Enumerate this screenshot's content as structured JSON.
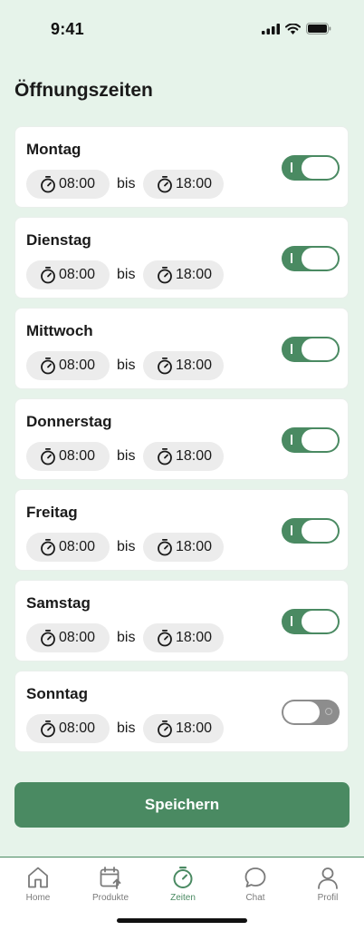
{
  "status_bar": {
    "time": "9:41"
  },
  "page": {
    "title": "Öffnungszeiten"
  },
  "days": [
    {
      "name": "Montag",
      "from": "08:00",
      "to": "18:00",
      "separator": "bis",
      "enabled": true
    },
    {
      "name": "Dienstag",
      "from": "08:00",
      "to": "18:00",
      "separator": "bis",
      "enabled": true
    },
    {
      "name": "Mittwoch",
      "from": "08:00",
      "to": "18:00",
      "separator": "bis",
      "enabled": true
    },
    {
      "name": "Donnerstag",
      "from": "08:00",
      "to": "18:00",
      "separator": "bis",
      "enabled": true
    },
    {
      "name": "Freitag",
      "from": "08:00",
      "to": "18:00",
      "separator": "bis",
      "enabled": true
    },
    {
      "name": "Samstag",
      "from": "08:00",
      "to": "18:00",
      "separator": "bis",
      "enabled": true
    },
    {
      "name": "Sonntag",
      "from": "08:00",
      "to": "18:00",
      "separator": "bis",
      "enabled": false
    }
  ],
  "save_label": "Speichern",
  "tabs": [
    {
      "label": "Home",
      "icon": "home-icon",
      "active": false
    },
    {
      "label": "Produkte",
      "icon": "calendar-upload-icon",
      "active": false
    },
    {
      "label": "Zeiten",
      "icon": "stopwatch-icon",
      "active": true
    },
    {
      "label": "Chat",
      "icon": "chat-bubble-icon",
      "active": false
    },
    {
      "label": "Profil",
      "icon": "user-icon",
      "active": false
    }
  ],
  "colors": {
    "accent": "#4a8a62",
    "background": "#e6f3ea",
    "toggle_off": "#8d8d8d",
    "pill": "#ececec"
  }
}
